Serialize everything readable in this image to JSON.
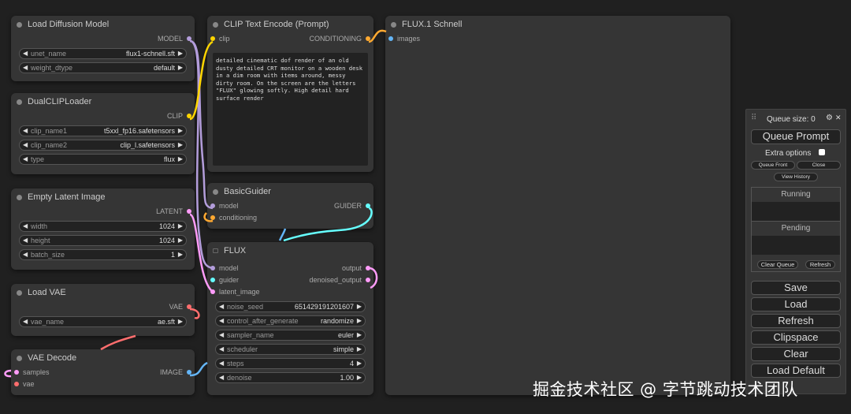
{
  "colors": {
    "model": "#b39ddb",
    "clip": "#ffd500",
    "conditioning": "#ffa931",
    "latent": "#ff9cf9",
    "vae": "#ff6e6e",
    "image": "#64b5f6",
    "guider": "#66ffff",
    "background": "#202020",
    "node": "#353535"
  },
  "nodes": {
    "load_diffusion": {
      "title": "Load Diffusion Model",
      "output": "MODEL",
      "widgets": [
        {
          "name": "unet_name",
          "value": "flux1-schnell.sft"
        },
        {
          "name": "weight_dtype",
          "value": "default"
        }
      ]
    },
    "dualclip": {
      "title": "DualCLIPLoader",
      "output": "CLIP",
      "widgets": [
        {
          "name": "clip_name1",
          "value": "t5xxl_fp16.safetensors"
        },
        {
          "name": "clip_name2",
          "value": "clip_l.safetensors"
        },
        {
          "name": "type",
          "value": "flux"
        }
      ]
    },
    "empty_latent": {
      "title": "Empty Latent Image",
      "output": "LATENT",
      "widgets": [
        {
          "name": "width",
          "value": "1024"
        },
        {
          "name": "height",
          "value": "1024"
        },
        {
          "name": "batch_size",
          "value": "1"
        }
      ]
    },
    "load_vae": {
      "title": "Load VAE",
      "output": "VAE",
      "widgets": [
        {
          "name": "vae_name",
          "value": "ae.sft"
        }
      ]
    },
    "vae_decode": {
      "title": "VAE Decode",
      "inputs": [
        "samples",
        "vae"
      ],
      "output": "IMAGE"
    },
    "clip_text": {
      "title": "CLIP Text Encode (Prompt)",
      "input": "clip",
      "output": "CONDITIONING",
      "prompt": "detailed cinematic dof render of an old dusty detailed CRT monitor on a wooden desk in a dim room with items around, messy dirty room. On the screen are the letters \"FLUX\" glowing softly. High detail hard surface render"
    },
    "basic_guider": {
      "title": "BasicGuider",
      "inputs": [
        "model",
        "conditioning"
      ],
      "output": "GUIDER"
    },
    "flux": {
      "title": "FLUX",
      "inputs": [
        "model",
        "guider",
        "latent_image"
      ],
      "outputs": [
        "output",
        "denoised_output"
      ],
      "widgets": [
        {
          "name": "noise_seed",
          "value": "651429191201607"
        },
        {
          "name": "control_after_generate",
          "value": "randomize"
        },
        {
          "name": "sampler_name",
          "value": "euler"
        },
        {
          "name": "scheduler",
          "value": "simple"
        },
        {
          "name": "steps",
          "value": "4"
        },
        {
          "name": "denoise",
          "value": "1.00"
        }
      ]
    },
    "preview": {
      "title": "FLUX.1 Schnell",
      "input": "images"
    }
  },
  "queue": {
    "size_label": "Queue size: 0",
    "queue_prompt": "Queue Prompt",
    "extra_options": "Extra options",
    "queue_front": "Queue Front",
    "close": "Close",
    "view_history": "View History",
    "running": "Running",
    "pending": "Pending",
    "clear_queue": "Clear Queue",
    "refresh_small": "Refresh",
    "buttons": [
      "Save",
      "Load",
      "Refresh",
      "Clipspace",
      "Clear",
      "Load Default"
    ]
  },
  "watermark": "掘金技术社区 @ 字节跳动技术团队",
  "icons": {
    "arrow_left": "◀",
    "arrow_right": "▶",
    "gear": "⚙",
    "close": "✕",
    "drag": "⠿"
  }
}
